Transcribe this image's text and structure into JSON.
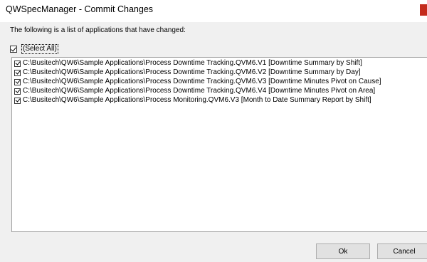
{
  "window": {
    "title": "QWSpecManager - Commit Changes"
  },
  "intro": "The following is a list of applications that have changed:",
  "select_all": {
    "label": "(Select All)",
    "checked": true
  },
  "items": [
    {
      "label": "C:\\Busitech\\QW6\\Sample Applications\\Process Downtime Tracking.QVM6.V1 [Downtime Summary by Shift]",
      "checked": true
    },
    {
      "label": "C:\\Busitech\\QW6\\Sample Applications\\Process Downtime Tracking.QVM6.V2 [Downtime Summary by Day]",
      "checked": true
    },
    {
      "label": "C:\\Busitech\\QW6\\Sample Applications\\Process Downtime Tracking.QVM6.V3 [Downtime Minutes Pivot on Cause]",
      "checked": true
    },
    {
      "label": "C:\\Busitech\\QW6\\Sample Applications\\Process Downtime Tracking.QVM6.V4 [Downtime Minutes Pivot on Area]",
      "checked": true
    },
    {
      "label": "C:\\Busitech\\QW6\\Sample Applications\\Process Monitoring.QVM6.V3 [Month to Date Summary Report by Shift]",
      "checked": true
    }
  ],
  "buttons": {
    "ok": "Ok",
    "cancel": "Cancel"
  },
  "colors": {
    "close_button": "#c42b1c",
    "dialog_background": "#f0f0f0"
  }
}
